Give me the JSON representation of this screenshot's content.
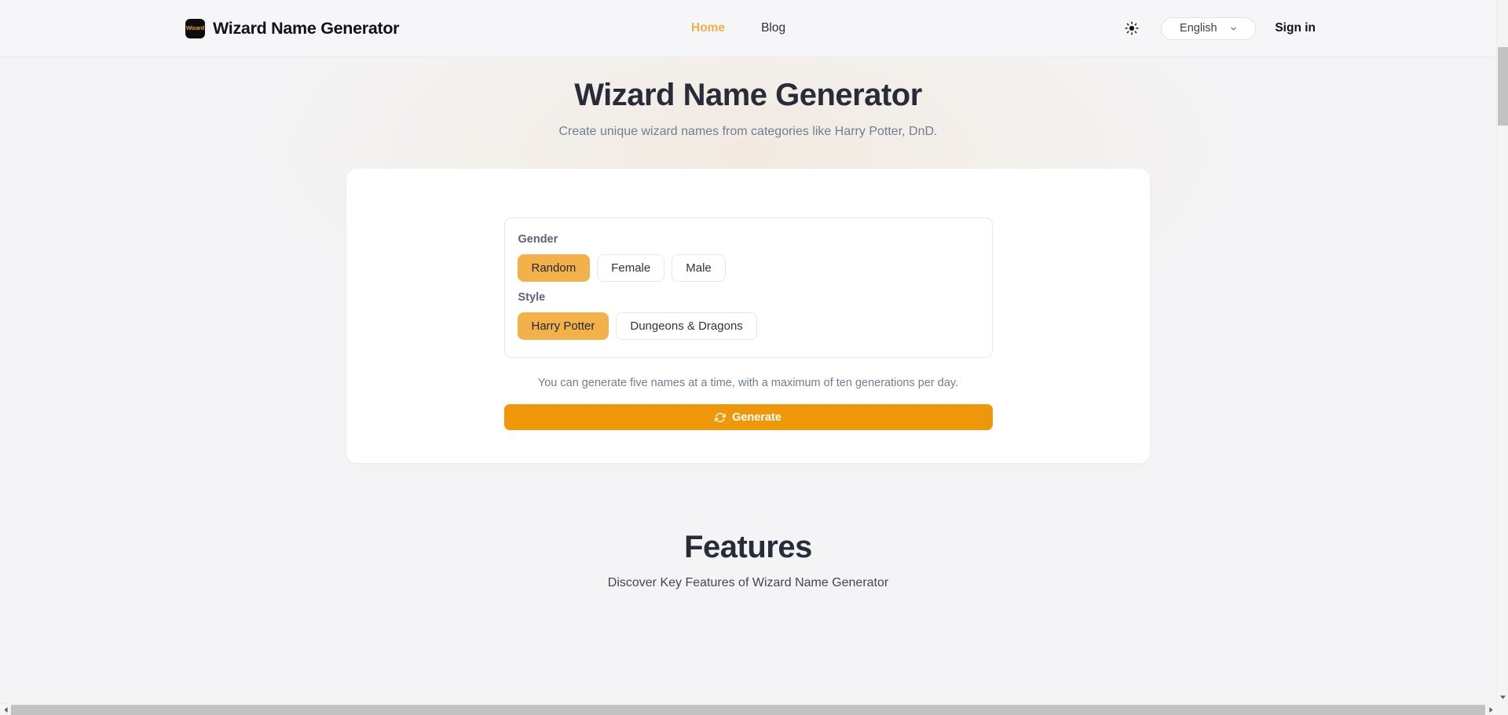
{
  "header": {
    "logo_text": "Wizard",
    "brand_name": "Wizard Name Generator",
    "nav": [
      {
        "label": "Home",
        "active": true
      },
      {
        "label": "Blog",
        "active": false
      }
    ],
    "theme_toggle_icon": "sun-icon",
    "language": {
      "selected": "English",
      "chevron_icon": "chevron-down-icon"
    },
    "sign_in_label": "Sign in"
  },
  "hero": {
    "title": "Wizard Name Generator",
    "subtitle": "Create unique wizard names from categories like Harry Potter, DnD."
  },
  "generator": {
    "gender": {
      "label": "Gender",
      "options": [
        {
          "label": "Random",
          "selected": true
        },
        {
          "label": "Female",
          "selected": false
        },
        {
          "label": "Male",
          "selected": false
        }
      ]
    },
    "style": {
      "label": "Style",
      "options": [
        {
          "label": "Harry Potter",
          "selected": true
        },
        {
          "label": "Dungeons & Dragons",
          "selected": false
        }
      ]
    },
    "hint": "You can generate five names at a time, with a maximum of ten generations per day.",
    "generate_button": {
      "label": "Generate",
      "icon": "refresh-icon"
    }
  },
  "features": {
    "title": "Features",
    "subtitle": "Discover Key Features of Wizard Name Generator"
  },
  "colors": {
    "accent": "#ee9709",
    "chip_selected": "#f2b249",
    "nav_active": "#efaf48",
    "page_bg": "#f4f4f6",
    "heading": "#282c38",
    "muted_text": "#717d93"
  }
}
